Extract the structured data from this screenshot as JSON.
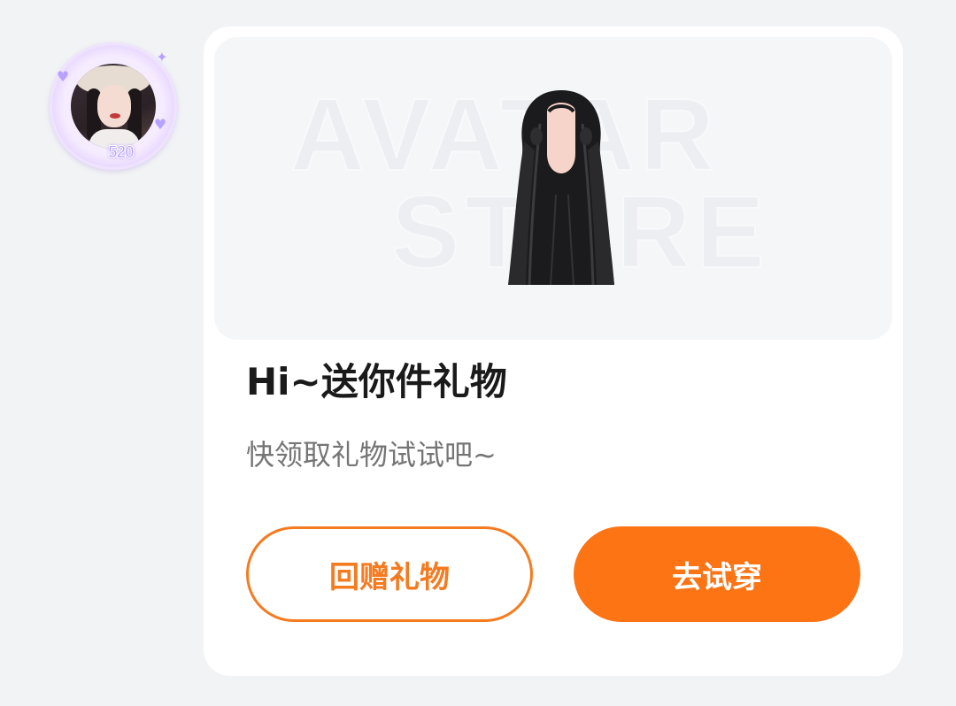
{
  "sender": {
    "avatar_badge": "520"
  },
  "gift_card": {
    "banner_watermark": [
      "AVATAR",
      "STORE"
    ],
    "item_icon": "long-black-hair-wig",
    "title": "Hi~送你件礼物",
    "subtitle": "快领取礼物试试吧~",
    "actions": {
      "return_gift_label": "回赠礼物",
      "try_on_label": "去试穿"
    }
  },
  "colors": {
    "page_background": "#f2f3f5",
    "card_background": "#ffffff",
    "banner_background": "#f5f6f8",
    "accent_orange": "#fd7415",
    "title_text": "#1a1a1a",
    "subtitle_text": "#757575"
  }
}
